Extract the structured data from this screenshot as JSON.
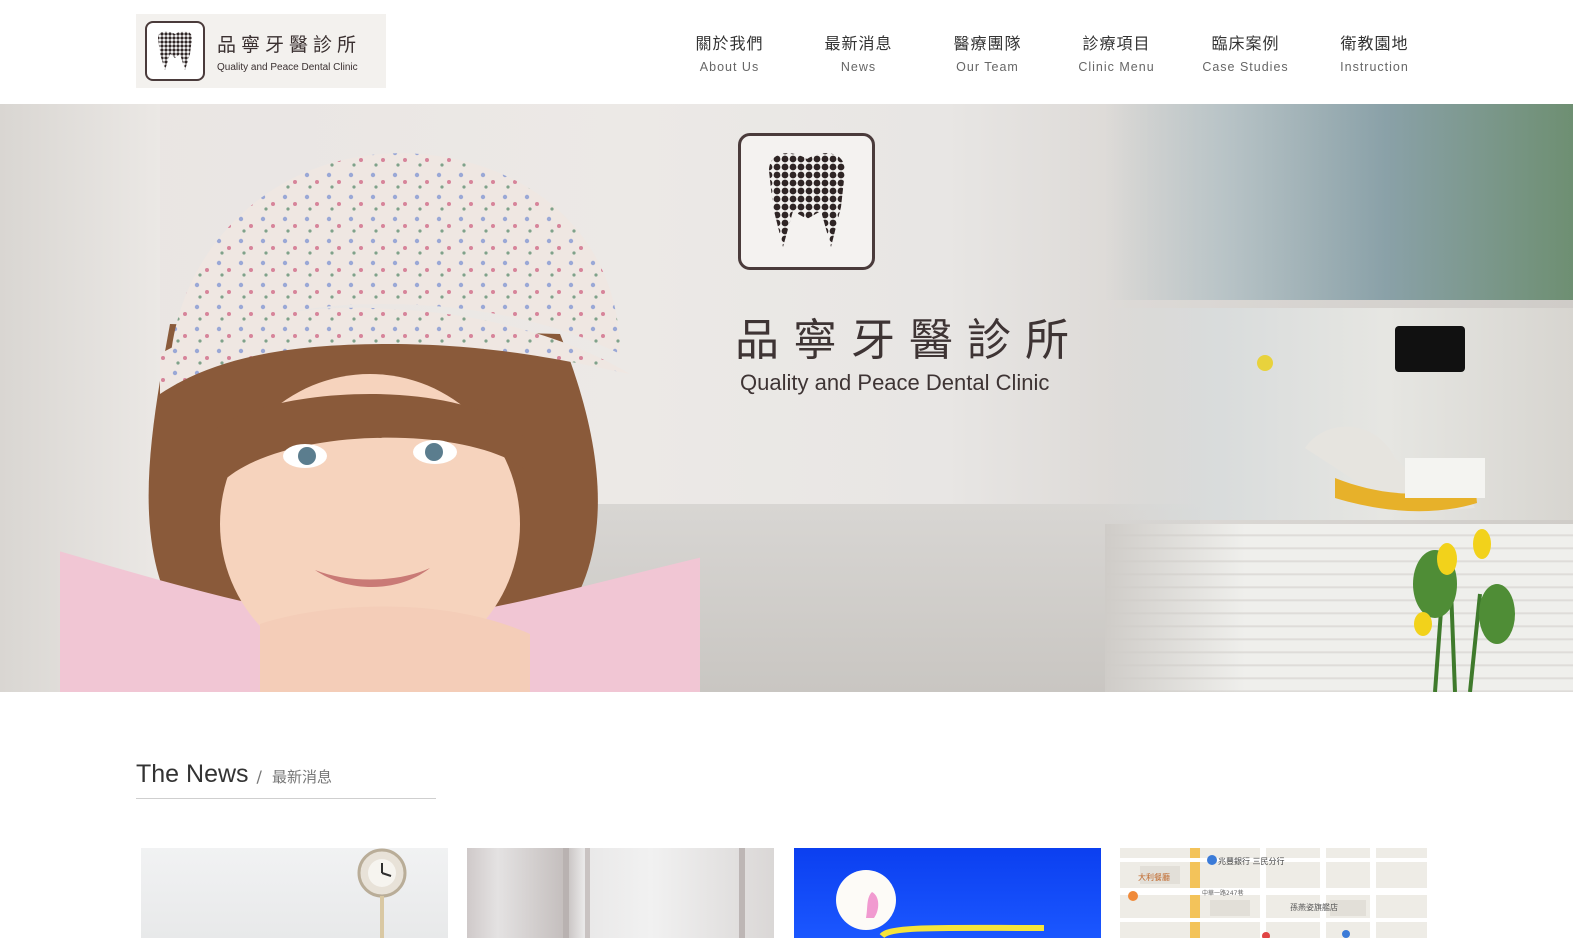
{
  "brand": {
    "name_zh": "品寧牙醫診所",
    "name_en": "Quality and Peace Dental Clinic"
  },
  "nav": [
    {
      "zh": "關於我們",
      "en": "About Us"
    },
    {
      "zh": "最新消息",
      "en": "News"
    },
    {
      "zh": "醫療團隊",
      "en": "Our Team"
    },
    {
      "zh": "診療項目",
      "en": "Clinic Menu"
    },
    {
      "zh": "臨床案例",
      "en": "Case Studies"
    },
    {
      "zh": "衛教園地",
      "en": "Instruction"
    }
  ],
  "hero": {
    "title_zh": "品寧牙醫診所",
    "title_en": "Quality and Peace Dental Clinic"
  },
  "news": {
    "title": "The News",
    "separator": "/",
    "title_zh": "最新消息"
  },
  "map_labels": [
    "兆豐銀行 三民分行",
    "大利餐廳",
    "中華一路247巷",
    "孫燕姿旗艦店"
  ],
  "colors": {
    "brand_dark": "#3e3434",
    "hero_bg": "#e9e4e2",
    "card_blue": "#1b57ff"
  }
}
